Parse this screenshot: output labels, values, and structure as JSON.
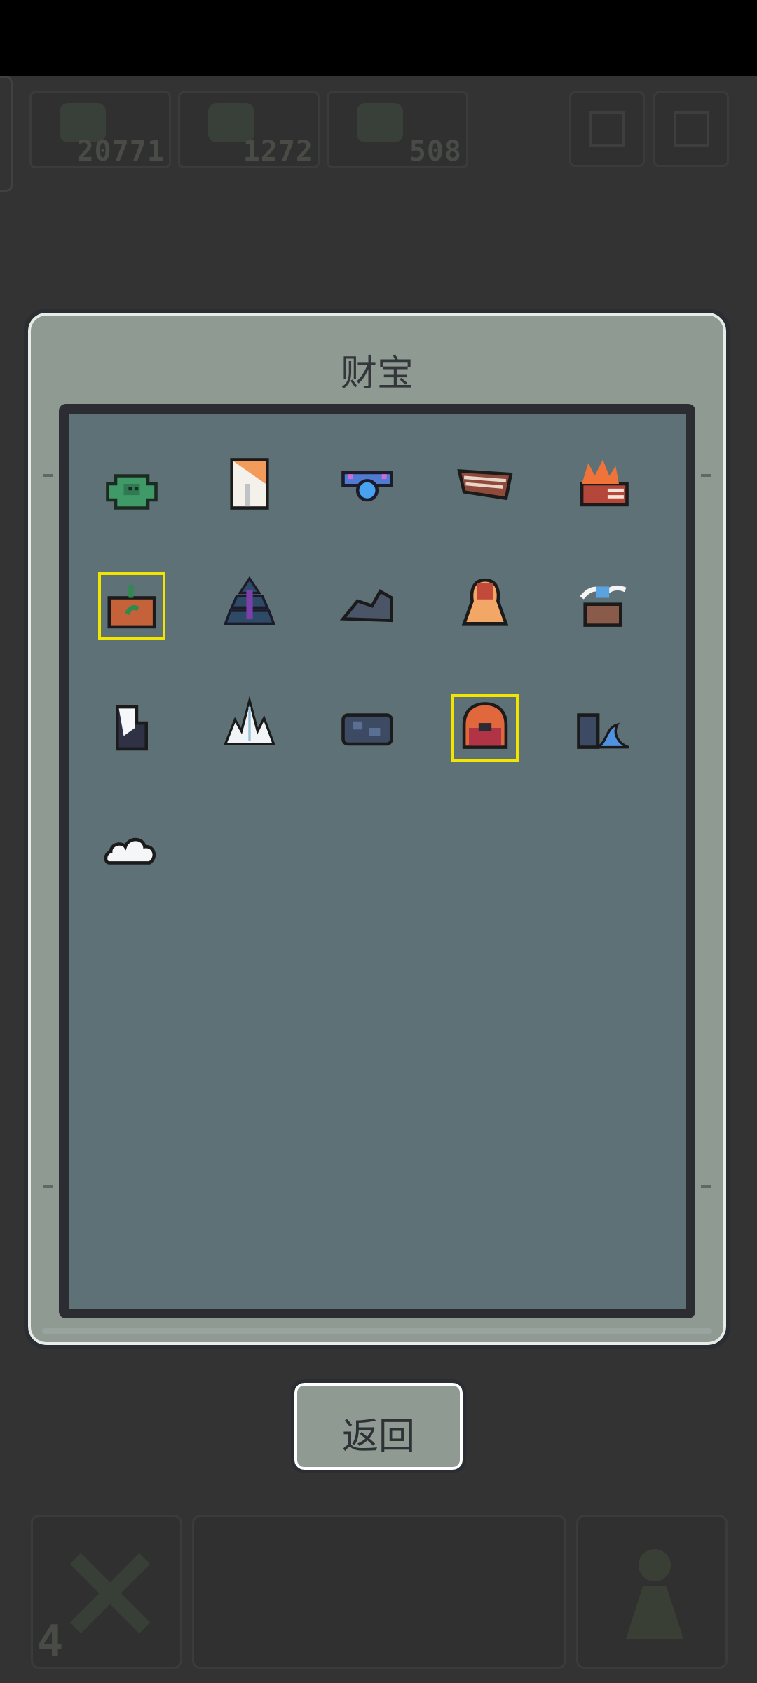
{
  "hud": {
    "resources": [
      {
        "icon": "ore-icon",
        "value": "20771"
      },
      {
        "icon": "wood-icon",
        "value": "1272"
      },
      {
        "icon": "crystal-icon",
        "value": "508"
      }
    ],
    "bottom": {
      "left_count": "4"
    }
  },
  "modal": {
    "title": "财宝",
    "items": [
      {
        "icon": "green-turtle-shell-icon"
      },
      {
        "icon": "paper-scroll-icon"
      },
      {
        "icon": "blue-orb-amulet-icon"
      },
      {
        "icon": "wooden-plank-icon"
      },
      {
        "icon": "flame-brick-icon"
      },
      {
        "icon": "potted-sprout-icon",
        "selected": true
      },
      {
        "icon": "dark-pagoda-icon"
      },
      {
        "icon": "slate-rock-icon"
      },
      {
        "icon": "amber-bell-icon"
      },
      {
        "icon": "wind-swirl-crate-icon"
      },
      {
        "icon": "snow-stone-icon"
      },
      {
        "icon": "ice-crystal-icon"
      },
      {
        "icon": "iron-ore-chunk-icon"
      },
      {
        "icon": "fire-cauldron-icon",
        "selected": true
      },
      {
        "icon": "wave-rock-icon"
      },
      {
        "icon": "white-cloud-icon"
      }
    ],
    "back_label": "返回"
  },
  "colors": {
    "selected_outline": "#f2e600",
    "panel": "#5e7177",
    "frame": "#8f9a93"
  }
}
